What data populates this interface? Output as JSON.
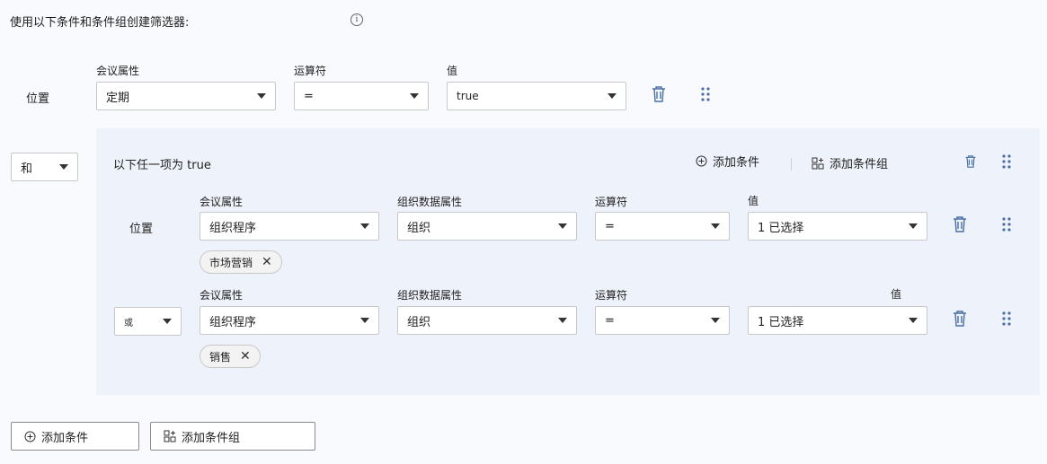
{
  "heading": "使用以下条件和条件组创建筛选器:",
  "info_icon": "info-icon",
  "row1": {
    "prefix": "位置",
    "labels": {
      "attr": "会议属性",
      "op": "运算符",
      "value": "值"
    },
    "attr": "定期",
    "op": "=",
    "value": "true"
  },
  "conj": "和",
  "group": {
    "title": "以下任一项为 true",
    "add_condition": "添加条件",
    "add_group": "添加条件组",
    "rows": [
      {
        "prefix": "位置",
        "labels": {
          "attr": "会议属性",
          "orgattr": "组织数据属性",
          "op": "运算符",
          "value": "值"
        },
        "attr": "组织程序",
        "orgattr": "组织",
        "op": "=",
        "value": "1 已选择",
        "chip": "市场营销"
      },
      {
        "conj": "或",
        "labels": {
          "attr": "会议属性",
          "orgattr": "组织数据属性",
          "op": "运算符",
          "value": "值"
        },
        "attr": "组织程序",
        "orgattr": "组织",
        "op": "=",
        "value": "1 已选择",
        "chip": "销售"
      }
    ]
  },
  "footer": {
    "add_condition": "添加条件",
    "add_group": "添加条件组"
  },
  "chip_remove": "✕",
  "colors": {
    "accent": "#4a6fa5",
    "group_bg": "#eef2fa",
    "page_bg": "#f9fafd"
  }
}
